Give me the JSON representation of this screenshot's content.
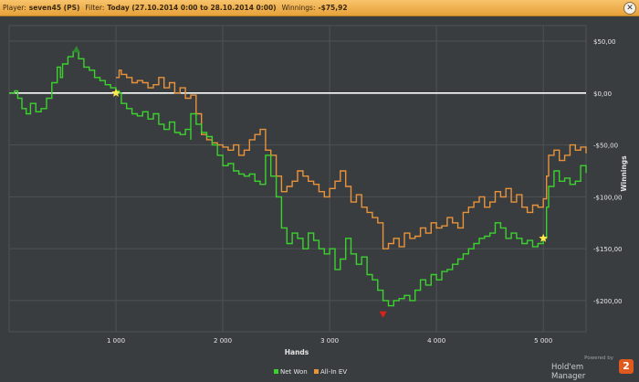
{
  "titlebar": {
    "player_label": "Player:",
    "player_value": "seven45 (PS)",
    "filter_label": "Filter:",
    "filter_value": "Today (27.10.2014 0:00 to 28.10.2014 0:00)",
    "winnings_label": "Winnings:",
    "winnings_value": "-$75,92",
    "close_glyph": "✕"
  },
  "branding": {
    "powered": "Powered by",
    "product": "Hold'em Manager",
    "badge": "2"
  },
  "colors": {
    "background": "#3a3d40",
    "grid": "#4e5256",
    "net_won": "#3bd22e",
    "allin_ev": "#e8933a",
    "zero_line": "#ffffff",
    "text": "#e6e6e6"
  },
  "chart_data": {
    "type": "line",
    "title": "",
    "xlabel": "Hands",
    "ylabel": "Winnings",
    "xlim": [
      0,
      5400
    ],
    "ylim": [
      -230,
      65
    ],
    "x_ticks": [
      1000,
      2000,
      3000,
      4000,
      5000
    ],
    "x_tick_labels": [
      "1 000",
      "2 000",
      "3 000",
      "4 000",
      "5 000"
    ],
    "y_ticks": [
      50,
      0,
      -50,
      -100,
      -150,
      -200
    ],
    "y_tick_labels": [
      "$50,00",
      "$0,00",
      "-$50,00",
      "-$100,00",
      "-$150,00",
      "-$200,00"
    ],
    "grid": true,
    "legend_position": "bottom-center",
    "series": [
      {
        "name": "Net Won",
        "color": "#3bd22e",
        "x": [
          0,
          50,
          80,
          120,
          160,
          200,
          250,
          300,
          350,
          400,
          450,
          480,
          500,
          550,
          600,
          650,
          700,
          750,
          800,
          850,
          900,
          950,
          1000,
          1030,
          1050,
          1100,
          1150,
          1200,
          1250,
          1300,
          1350,
          1400,
          1450,
          1500,
          1550,
          1600,
          1650,
          1700,
          1700,
          1750,
          1800,
          1850,
          1900,
          1950,
          2000,
          2050,
          2100,
          2150,
          2200,
          2250,
          2300,
          2350,
          2400,
          2450,
          2500,
          2550,
          2600,
          2650,
          2700,
          2750,
          2800,
          2850,
          2900,
          2950,
          3000,
          3050,
          3100,
          3150,
          3200,
          3250,
          3300,
          3350,
          3400,
          3450,
          3500,
          3550,
          3600,
          3650,
          3700,
          3750,
          3800,
          3850,
          3900,
          3950,
          4000,
          4050,
          4100,
          4150,
          4200,
          4250,
          4300,
          4350,
          4400,
          4450,
          4500,
          4550,
          4600,
          4650,
          4700,
          4750,
          4800,
          4850,
          4900,
          4950,
          5000,
          5030,
          5050,
          5100,
          5150,
          5200,
          5250,
          5300,
          5350,
          5400
        ],
        "y": [
          0,
          2,
          -5,
          -15,
          -20,
          -10,
          -18,
          -15,
          -5,
          10,
          25,
          15,
          28,
          35,
          40,
          33,
          25,
          22,
          15,
          12,
          8,
          5,
          2,
          0,
          -10,
          -15,
          -20,
          -22,
          -18,
          -25,
          -20,
          -30,
          -35,
          -28,
          -38,
          -40,
          -35,
          -45,
          -20,
          -30,
          -38,
          -42,
          -50,
          -60,
          -70,
          -68,
          -75,
          -78,
          -80,
          -78,
          -85,
          -88,
          -60,
          -80,
          -100,
          -130,
          -145,
          -135,
          -140,
          -150,
          -135,
          -142,
          -150,
          -155,
          -150,
          -170,
          -160,
          -140,
          -155,
          -165,
          -158,
          -175,
          -180,
          -190,
          -200,
          -205,
          -200,
          -198,
          -195,
          -200,
          -190,
          -180,
          -185,
          -175,
          -180,
          -172,
          -170,
          -165,
          -160,
          -155,
          -150,
          -145,
          -140,
          -138,
          -135,
          -125,
          -130,
          -140,
          -135,
          -140,
          -145,
          -142,
          -148,
          -145,
          -140,
          -110,
          -90,
          -75,
          -85,
          -82,
          -88,
          -85,
          -70,
          -77
        ]
      },
      {
        "name": "All-In EV",
        "color": "#e8933a",
        "x": [
          1000,
          1030,
          1050,
          1100,
          1150,
          1200,
          1250,
          1300,
          1350,
          1400,
          1450,
          1500,
          1550,
          1600,
          1650,
          1700,
          1750,
          1800,
          1850,
          1900,
          1950,
          2000,
          2050,
          2100,
          2150,
          2200,
          2250,
          2300,
          2350,
          2400,
          2450,
          2500,
          2550,
          2600,
          2650,
          2700,
          2750,
          2800,
          2850,
          2900,
          2950,
          3000,
          3050,
          3100,
          3150,
          3200,
          3250,
          3300,
          3350,
          3400,
          3450,
          3500,
          3550,
          3600,
          3650,
          3700,
          3750,
          3800,
          3850,
          3900,
          3950,
          4000,
          4050,
          4100,
          4150,
          4200,
          4250,
          4300,
          4350,
          4400,
          4450,
          4500,
          4550,
          4600,
          4650,
          4700,
          4750,
          4800,
          4850,
          4900,
          4950,
          5000,
          5030,
          5050,
          5100,
          5150,
          5200,
          5250,
          5300,
          5350,
          5400
        ],
        "y": [
          15,
          22,
          18,
          15,
          10,
          12,
          10,
          5,
          8,
          15,
          5,
          10,
          0,
          5,
          -5,
          -2,
          -20,
          -40,
          -45,
          -48,
          -50,
          -52,
          -55,
          -50,
          -60,
          -55,
          -45,
          -40,
          -35,
          -55,
          -60,
          -80,
          -95,
          -90,
          -85,
          -75,
          -80,
          -85,
          -88,
          -95,
          -100,
          -92,
          -85,
          -75,
          -90,
          -105,
          -98,
          -110,
          -115,
          -120,
          -125,
          -150,
          -145,
          -140,
          -148,
          -135,
          -140,
          -138,
          -130,
          -135,
          -125,
          -130,
          -128,
          -120,
          -125,
          -130,
          -115,
          -110,
          -105,
          -100,
          -110,
          -105,
          -95,
          -100,
          -92,
          -105,
          -98,
          -110,
          -115,
          -108,
          -110,
          -102,
          -80,
          -60,
          -55,
          -65,
          -60,
          -50,
          -55,
          -52,
          -58
        ]
      }
    ],
    "markers": [
      {
        "label": "max",
        "x": 630,
        "y": 42,
        "color": "#2e8b2e",
        "shape": "triangle-up"
      },
      {
        "label": "star",
        "x": 1000,
        "y": 0,
        "color": "#ffe84a",
        "shape": "star"
      },
      {
        "label": "min",
        "x": 3500,
        "y": -213,
        "color": "#e0201a",
        "shape": "triangle-down"
      },
      {
        "label": "star",
        "x": 5000,
        "y": -140,
        "color": "#ffe84a",
        "shape": "star"
      }
    ]
  }
}
